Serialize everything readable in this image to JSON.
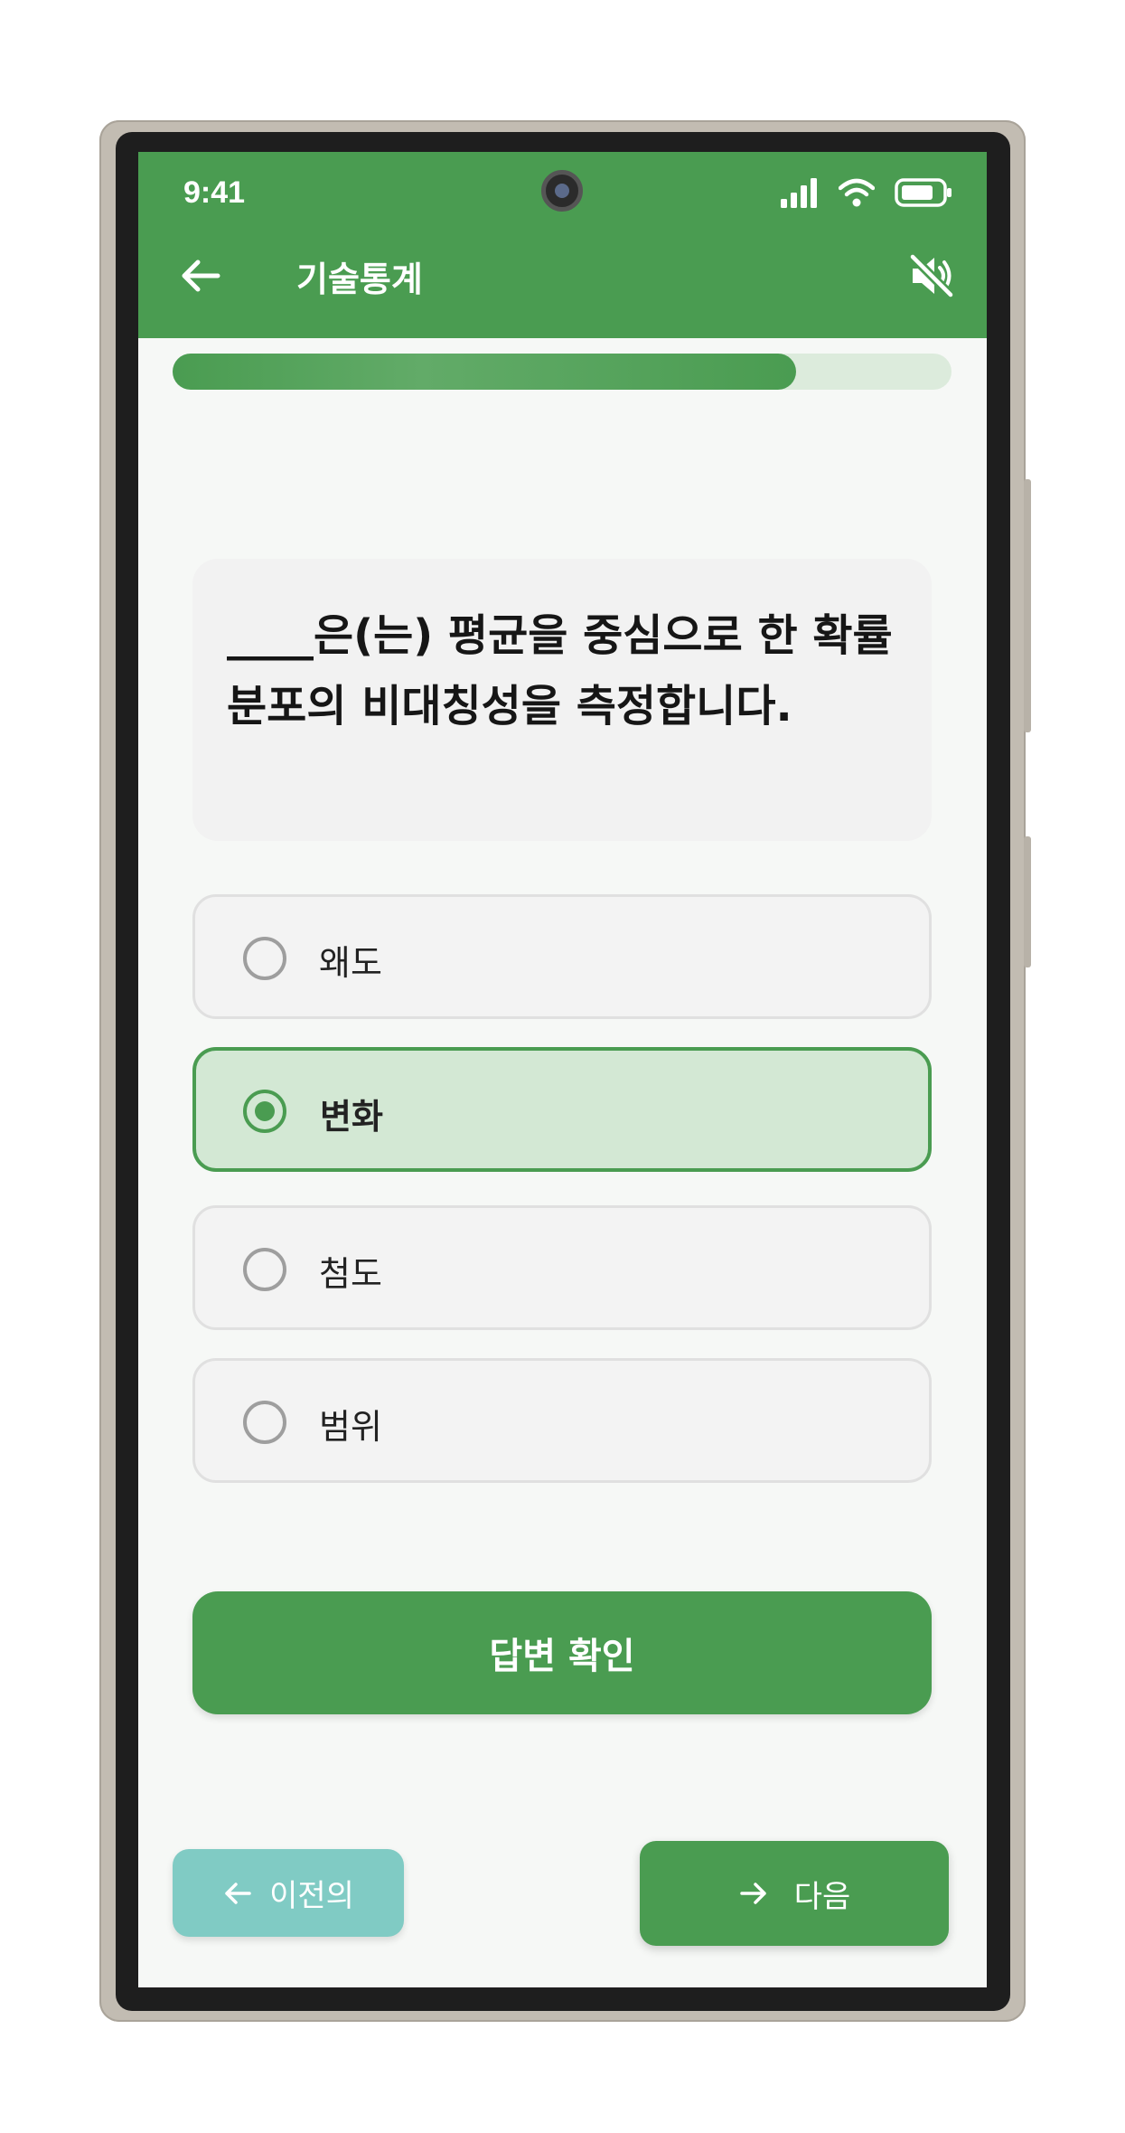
{
  "status_bar": {
    "time": "9:41"
  },
  "header": {
    "title": "기술통계"
  },
  "progress": {
    "value": 0.8
  },
  "question": {
    "text": "____은(는) 평균을 중심으로 한 확률 분포의 비대칭성을 측정합니다."
  },
  "options": [
    {
      "label": "왜도",
      "selected": false
    },
    {
      "label": "변화",
      "selected": true
    },
    {
      "label": "첨도",
      "selected": false
    },
    {
      "label": "범위",
      "selected": false
    }
  ],
  "check_button": {
    "label": "답변 확인"
  },
  "nav": {
    "prev_label": "이전의",
    "next_label": "다음"
  },
  "colors": {
    "primary": "#4a9c51",
    "secondary": "#80cbc4",
    "selected_bg": "#d3e8d4"
  },
  "icons": {
    "back": "arrow-left-icon",
    "mute": "volume-mute-icon",
    "signal": "signal-icon",
    "wifi": "wifi-icon",
    "battery": "battery-icon"
  }
}
